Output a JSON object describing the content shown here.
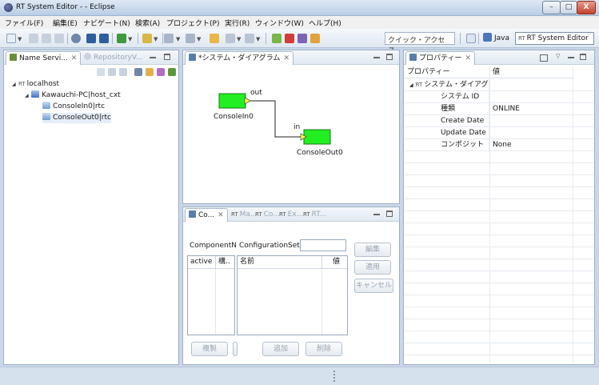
{
  "window": {
    "title": "RT System Editor -  - Eclipse",
    "min": "–",
    "max": "□",
    "close": "X"
  },
  "menubar": [
    "ファイル(F)",
    "編集(E)",
    "ナビゲート(N)",
    "検索(A)",
    "プロジェクト(P)",
    "実行(R)",
    "ウィンドウ(W)",
    "ヘルプ(H)"
  ],
  "toolbar": {
    "quick_access_placeholder": "クイック・アクセス",
    "perspective_java": "Java",
    "perspective_rtse": "RT System Editor",
    "rt_mark": "RT"
  },
  "name_service": {
    "tab_label": "Name Servi...",
    "tab2_label": "RepositoryV...",
    "tree": {
      "root": "localhost",
      "host": "Kawauchi-PC|host_cxt",
      "components": [
        "ConsoleIn0|rtc",
        "ConsoleOut0|rtc"
      ]
    }
  },
  "diagram": {
    "tab_label": "*システム・ダイアグラム",
    "components": [
      {
        "name": "ConsoleIn0",
        "port": "out"
      },
      {
        "name": "ConsoleOut0",
        "port": "in"
      }
    ],
    "colors": {
      "component": "#22ee22",
      "port": "#ffff44"
    }
  },
  "config": {
    "tabs": [
      "Co...",
      "Ma...",
      "Co...",
      "Ex...",
      "RT..."
    ],
    "component_name_label": "ComponentNa",
    "configuration_set_label": "ConfigurationSet:",
    "left_columns": [
      "active",
      "構.."
    ],
    "right_columns": [
      "名前",
      "値"
    ],
    "buttons": {
      "edit": "編集",
      "apply": "適用",
      "cancel": "キャンセル",
      "copy": "複製",
      "add": "追加",
      "delete": "削除"
    }
  },
  "properties": {
    "tab_label": "プロパティー",
    "headers": [
      "プロパティー",
      "値"
    ],
    "root_label": "システム・ダイアグ",
    "rows": [
      {
        "key": "システム ID",
        "value": ""
      },
      {
        "key": "種類",
        "value": "ONLINE"
      },
      {
        "key": "Create Date",
        "value": ""
      },
      {
        "key": "Update Date",
        "value": ""
      },
      {
        "key": "コンポジット",
        "value": "None"
      }
    ]
  }
}
